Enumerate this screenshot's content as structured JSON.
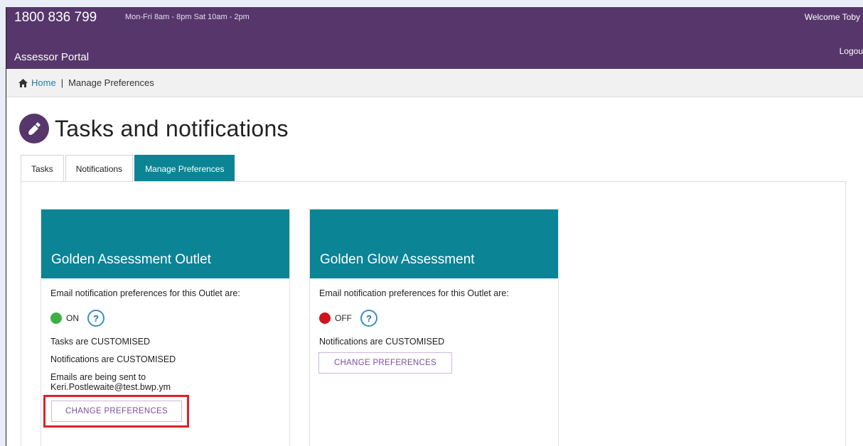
{
  "header": {
    "phone": "1800 836 799",
    "hours": "Mon-Fri 8am - 8pm Sat 10am - 2pm",
    "portal_name": "Assessor Portal",
    "welcome": "Welcome Toby",
    "logout": "Logou"
  },
  "breadcrumb": {
    "home": "Home",
    "separator": "|",
    "current": "Manage Preferences"
  },
  "page": {
    "title": "Tasks and notifications"
  },
  "tabs": [
    {
      "label": "Tasks",
      "active": false
    },
    {
      "label": "Notifications",
      "active": false
    },
    {
      "label": "Manage Preferences",
      "active": true
    }
  ],
  "cards": [
    {
      "title": "Golden Assessment Outlet",
      "pref_label": "Email notification preferences for this Outlet are:",
      "status": "ON",
      "status_color": "#3cb043",
      "help": "?",
      "lines": [
        "Tasks are CUSTOMISED",
        "Notifications are CUSTOMISED"
      ],
      "email_prefix": "Emails are being sent to",
      "email": "Keri.Postlewaite@test.bwp.ym",
      "button": "CHANGE PREFERENCES",
      "highlighted": true
    },
    {
      "title": "Golden Glow Assessment",
      "pref_label": "Email notification preferences for this Outlet are:",
      "status": "OFF",
      "status_color": "#d0141c",
      "help": "?",
      "lines": [
        "Notifications are CUSTOMISED"
      ],
      "button": "CHANGE PREFERENCES",
      "highlighted": false
    }
  ],
  "colors": {
    "header_bg": "#56366b",
    "accent": "#0b8496",
    "highlight": "#e0202a"
  }
}
